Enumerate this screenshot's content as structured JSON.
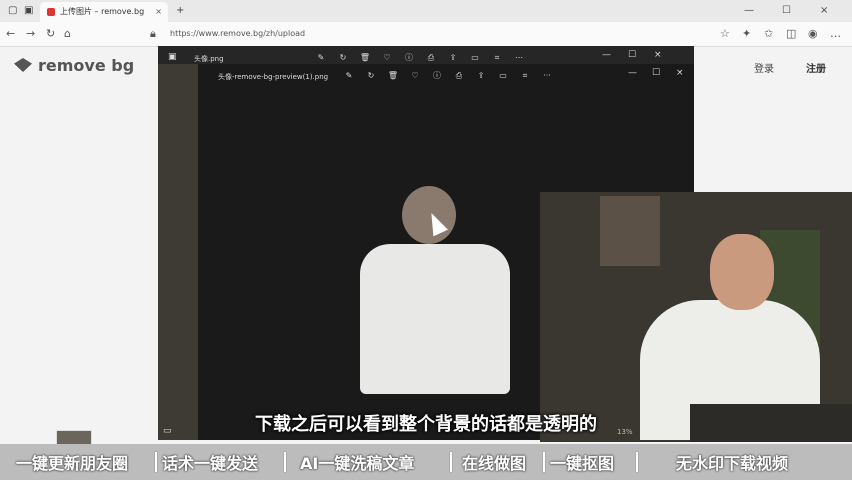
{
  "browser": {
    "tab_title": "上传图片 – remove.bg",
    "tab_close": "×",
    "new_tab": "+",
    "url": "https://www.remove.bg/zh/upload",
    "window_controls": [
      "—",
      "☐",
      "×"
    ]
  },
  "site": {
    "logo": "remove bg",
    "login": "登录",
    "signup": "注册"
  },
  "viewer_back": {
    "title": "头像.png",
    "controls": [
      "—",
      "☐",
      "×"
    ]
  },
  "viewer_front": {
    "title": "头像-remove-bg-preview(1).png",
    "controls": [
      "—",
      "☐",
      "×"
    ],
    "more": "···",
    "zoom": "13%"
  },
  "subtitle": "下载之后可以看到整个背景的话都是透明的",
  "banner": {
    "items": [
      "一键更新朋友圈",
      "话术一键发送",
      "AI一键洗稿文章",
      "在线做图",
      "一键抠图",
      "无水印下载视频"
    ]
  }
}
